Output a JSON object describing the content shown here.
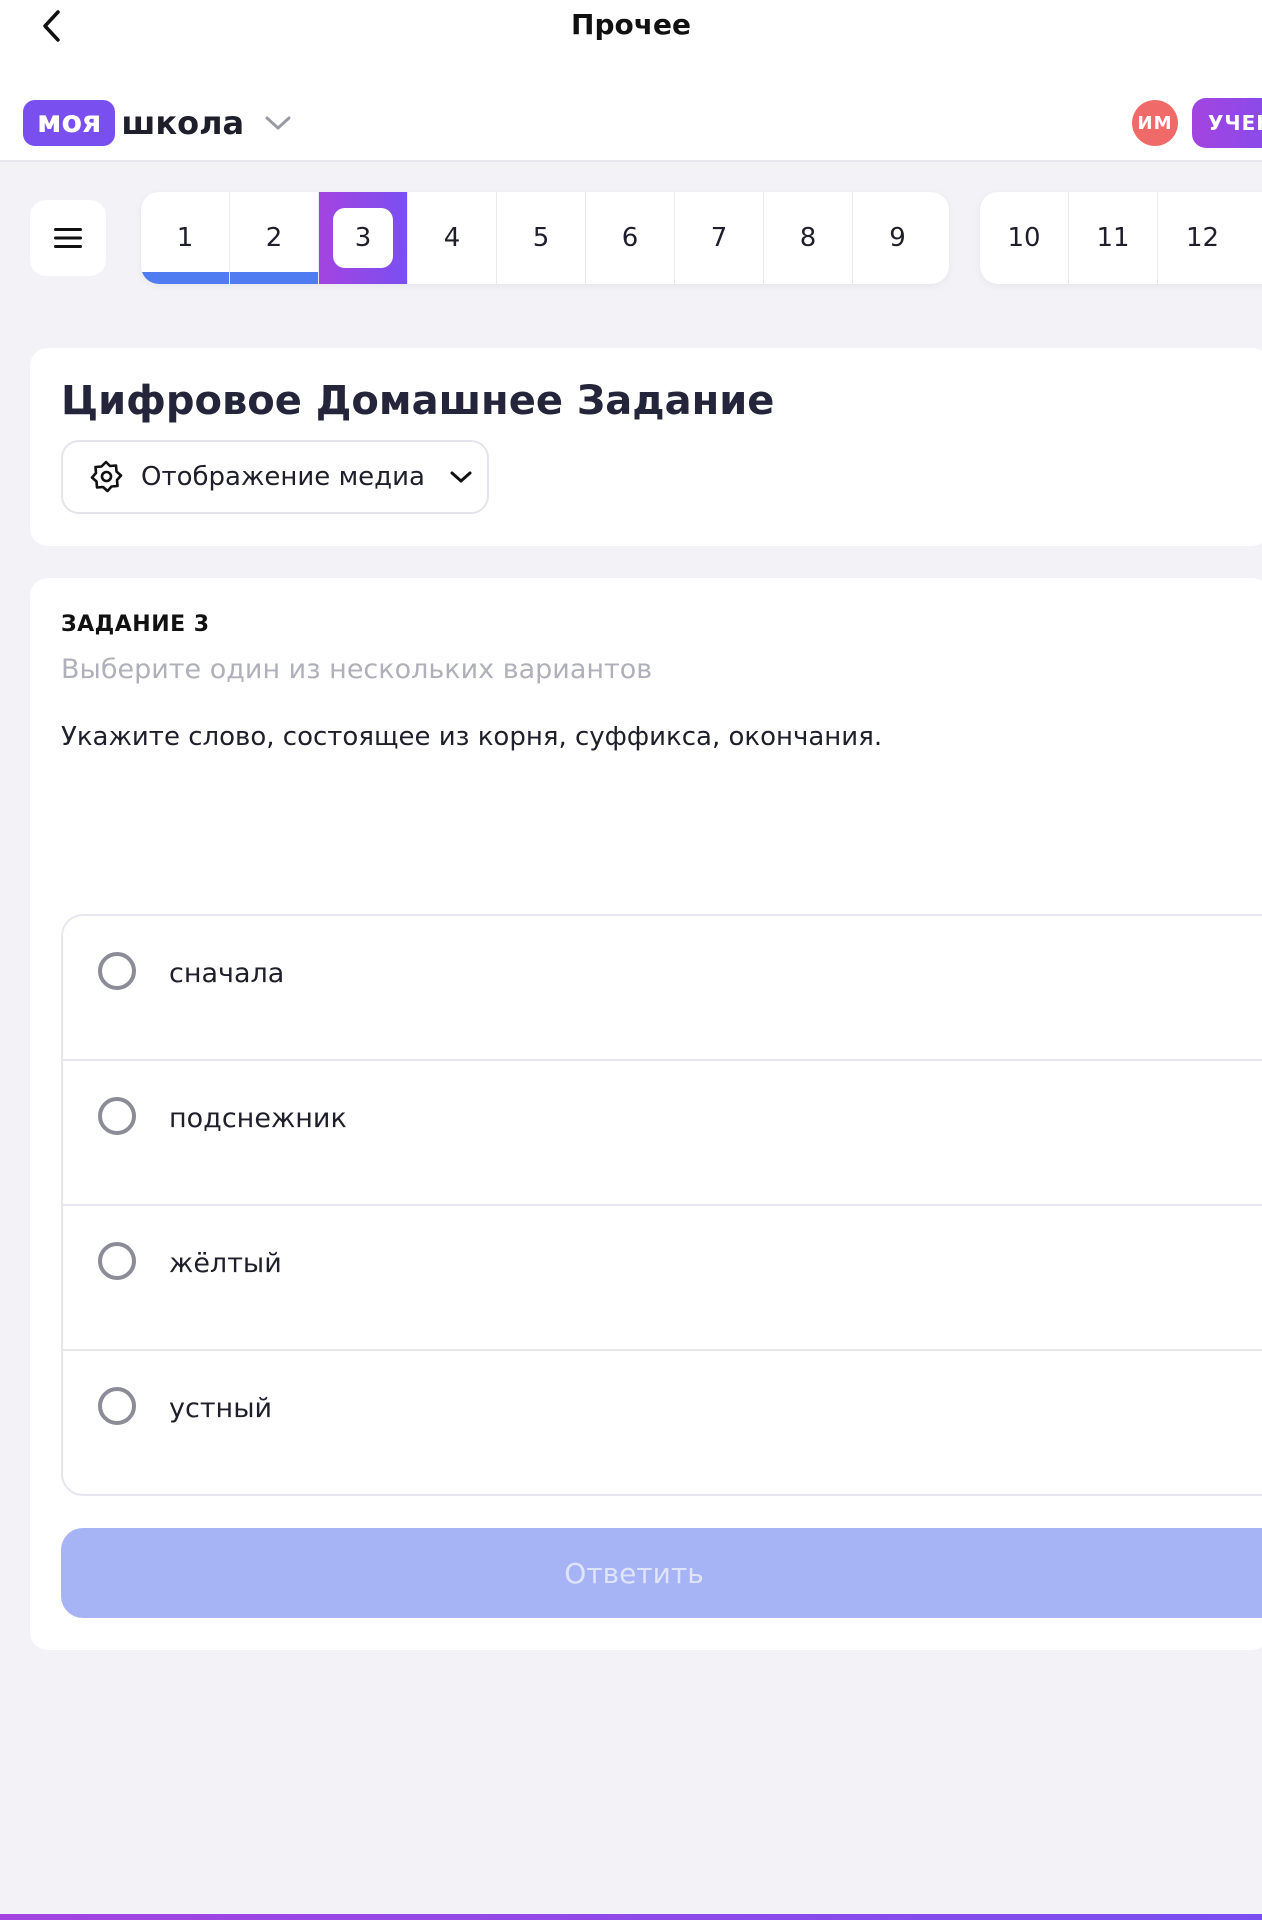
{
  "nav": {
    "title": "Прочее"
  },
  "header": {
    "logo_badge": "моя",
    "logo_text": "школа",
    "avatar_initials": "ИМ",
    "role_label": "УЧЕН"
  },
  "tasks": {
    "strip_one": [
      {
        "label": "1",
        "state": "done"
      },
      {
        "label": "2",
        "state": "done"
      },
      {
        "label": "3",
        "state": "current"
      },
      {
        "label": "4",
        "state": "todo"
      },
      {
        "label": "5",
        "state": "todo"
      },
      {
        "label": "6",
        "state": "todo"
      },
      {
        "label": "7",
        "state": "todo"
      },
      {
        "label": "8",
        "state": "todo"
      },
      {
        "label": "9",
        "state": "todo"
      }
    ],
    "strip_two": [
      {
        "label": "10",
        "state": "todo"
      },
      {
        "label": "11",
        "state": "todo"
      },
      {
        "label": "12",
        "state": "todo"
      }
    ]
  },
  "page": {
    "title": "Цифровое Домашнее Задание",
    "media_button_label": "Отображение медиа"
  },
  "task": {
    "label": "ЗАДАНИЕ 3",
    "hint": "Выберите один из нескольких вариантов",
    "question": "Укажите слово, состоящее из корня, суффикса, окончания.",
    "options": [
      "сначала",
      "подснежник",
      "жёлтый",
      "устный"
    ],
    "submit_label": "Ответить"
  },
  "colors": {
    "accent": "#7a4ff0",
    "accent_gradient_start": "#a344e0",
    "done": "#4f7cf0",
    "avatar": "#f06a6a",
    "submit_disabled": "#a6b4f5"
  },
  "icons": {
    "back": "chevron-left-icon",
    "logo_chevron": "chevron-down-icon",
    "menu": "hamburger-menu-icon",
    "media": "gear-icon",
    "media_chevron": "chevron-down-icon"
  }
}
